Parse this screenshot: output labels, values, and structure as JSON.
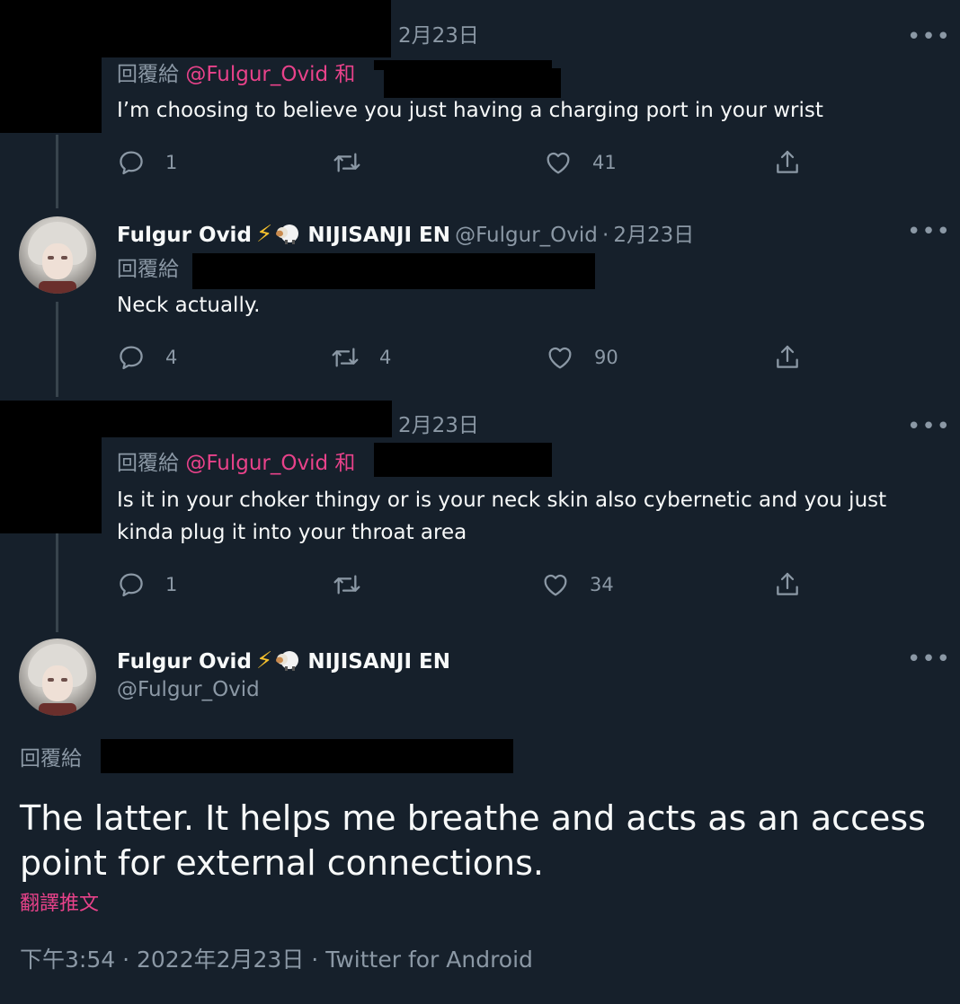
{
  "tweets": [
    {
      "date": "2月23日",
      "reply_prefix": "回覆給",
      "mention": "@Fulgur_Ovid",
      "conj": "和",
      "text": "I’m choosing to believe you just having a charging port in your wrist",
      "reply_count": "1",
      "retweet_count": "",
      "like_count": "41"
    },
    {
      "display_name": "Fulgur Ovid",
      "org": "NIJISANJI EN",
      "handle": "@Fulgur_Ovid",
      "separator": "·",
      "date": "2月23日",
      "reply_prefix": "回覆給",
      "text": "Neck actually.",
      "reply_count": "4",
      "retweet_count": "4",
      "like_count": "90"
    },
    {
      "date": "2月23日",
      "reply_prefix": "回覆給",
      "mention": "@Fulgur_Ovid",
      "conj": "和",
      "text_line1": "Is it in your choker thingy or is your neck skin also cybernetic and you just",
      "text_line2": "kinda plug it into your throat area",
      "reply_count": "1",
      "retweet_count": "",
      "like_count": "34"
    }
  ],
  "main_tweet": {
    "display_name": "Fulgur Ovid",
    "org": "NIJISANJI EN",
    "handle": "@Fulgur_Ovid",
    "reply_prefix": "回覆給",
    "text_line1": "The latter. It helps me breathe and acts as an access",
    "text_line2": "point for external connections.",
    "translate": "翻譯推文",
    "time": "下午3:54",
    "separator": "·",
    "date": "2022年2月23日",
    "source": "Twitter for Android"
  },
  "colors": {
    "background": "#16202b",
    "text_primary": "#f7f9f9",
    "text_secondary": "#8b98a5",
    "accent_mention": "#e8428a",
    "thread_line": "#38444d",
    "lightning": "#f5c02c"
  },
  "icons": [
    "more-icon",
    "reply-icon",
    "retweet-icon",
    "like-icon",
    "share-icon",
    "lightning-emoji",
    "sheep-emoji"
  ]
}
